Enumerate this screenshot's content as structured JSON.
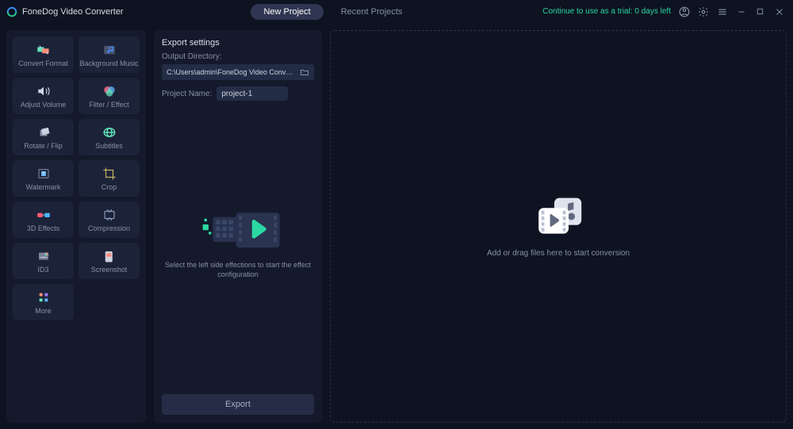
{
  "app": {
    "name": "FoneDog Video Converter",
    "trial_text": "Continue to use as a trial: 0 days left"
  },
  "tabs": {
    "new_project": "New Project",
    "recent_projects": "Recent Projects"
  },
  "sidebar": {
    "items": [
      {
        "label": "Convert Format"
      },
      {
        "label": "Background Music"
      },
      {
        "label": "Adjust Volume"
      },
      {
        "label": "Filter / Effect"
      },
      {
        "label": "Rotate / Flip"
      },
      {
        "label": "Subtitles"
      },
      {
        "label": "Watermark"
      },
      {
        "label": "Crop"
      },
      {
        "label": "3D Effects"
      },
      {
        "label": "Compression"
      },
      {
        "label": "ID3"
      },
      {
        "label": "Screenshot"
      },
      {
        "label": "More"
      }
    ]
  },
  "settings": {
    "title": "Export settings",
    "output_dir_label": "Output Directory:",
    "output_dir_value": "C:\\Users\\admin\\FoneDog Video Converter\\Converted",
    "project_name_label": "Project Name:",
    "project_name_value": "project-1",
    "mid_text": "Select the left side effections to start the effect configuration",
    "export_label": "Export"
  },
  "drop": {
    "text": "Add or drag files here to start conversion"
  }
}
